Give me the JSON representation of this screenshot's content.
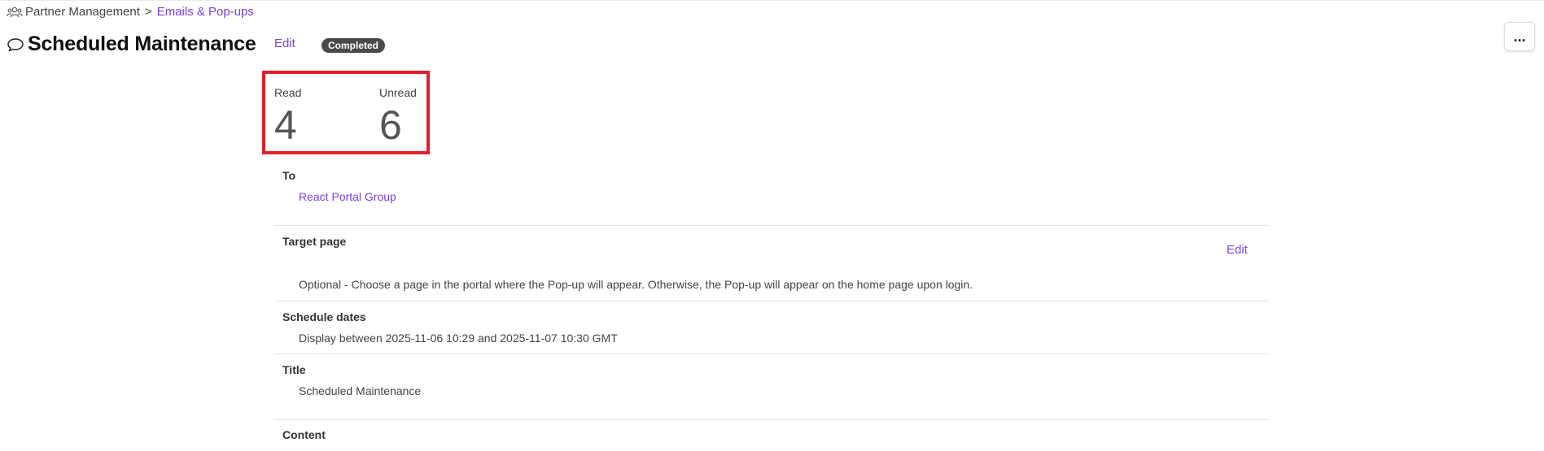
{
  "breadcrumb": {
    "root": "Partner Management",
    "separator": ">",
    "current": "Emails & Pop-ups"
  },
  "header": {
    "title": "Scheduled Maintenance",
    "edit_label": "Edit",
    "status": "Completed",
    "more_label": "..."
  },
  "stats": {
    "read_label": "Read",
    "read_value": "4",
    "unread_label": "Unread",
    "unread_value": "6"
  },
  "details": {
    "to_label": "To",
    "to_value": "React Portal Group",
    "target_label": "Target page",
    "target_edit": "Edit",
    "target_value": "Optional - Choose a page in the portal where the Pop-up will appear. Otherwise, the Pop-up will appear on the home page upon login.",
    "schedule_label": "Schedule dates",
    "schedule_value": "Display between 2025-11-06 10:29 and 2025-11-07 10:30 GMT",
    "title_label": "Title",
    "title_value": "Scheduled Maintenance",
    "content_label": "Content"
  },
  "colors": {
    "accent": "#7b3fe4",
    "highlight": "#e0202a",
    "badge": "#4a4a4a"
  }
}
